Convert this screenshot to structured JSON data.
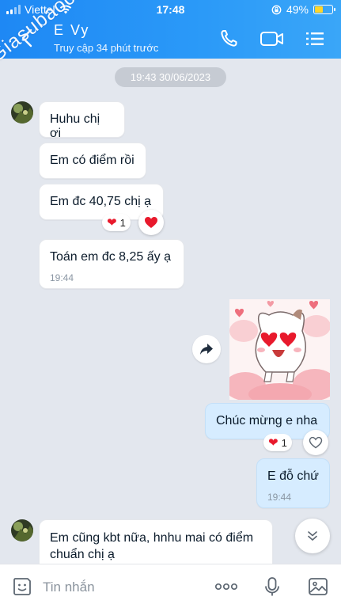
{
  "status_bar": {
    "carrier": "Viettel",
    "time": "17:48",
    "battery": "49%"
  },
  "header": {
    "contact_name": "E Vy",
    "last_seen": "Truy cập 34 phút trước",
    "icons": [
      "back-arrow-icon",
      "phone-icon",
      "video-call-icon",
      "menu-list-icon"
    ]
  },
  "watermark": "Giasubaochau.net",
  "date_separator": "19:43 30/06/2023",
  "messages": [
    {
      "sender": "them",
      "text": "Huhu chị ơi"
    },
    {
      "sender": "them",
      "text": "Em có điểm rồi"
    },
    {
      "sender": "them",
      "text": "Em đc 40,75 chị ạ",
      "reaction": {
        "emoji": "❤",
        "count": "1"
      }
    },
    {
      "sender": "them",
      "text": "Toán em đc 8,25 ấy ạ",
      "time": "19:44"
    },
    {
      "sender": "me",
      "type": "sticker",
      "sticker": "heart-eyes-sticker"
    },
    {
      "sender": "me",
      "text": "Chúc mừng e nha",
      "reaction": {
        "emoji": "❤",
        "count": "1"
      }
    },
    {
      "sender": "me",
      "text": "E đỗ chứ",
      "time": "19:44"
    },
    {
      "sender": "them",
      "text": "Em cũng kbt nữa, hnhu mai có điểm chuẩn chị ạ"
    }
  ],
  "input": {
    "placeholder": "Tin nhắn"
  },
  "colors": {
    "header": "#1e88f4",
    "outgoing_bubble": "#d6ecff",
    "background": "#e3e7ee",
    "heart": "#e8192c"
  }
}
